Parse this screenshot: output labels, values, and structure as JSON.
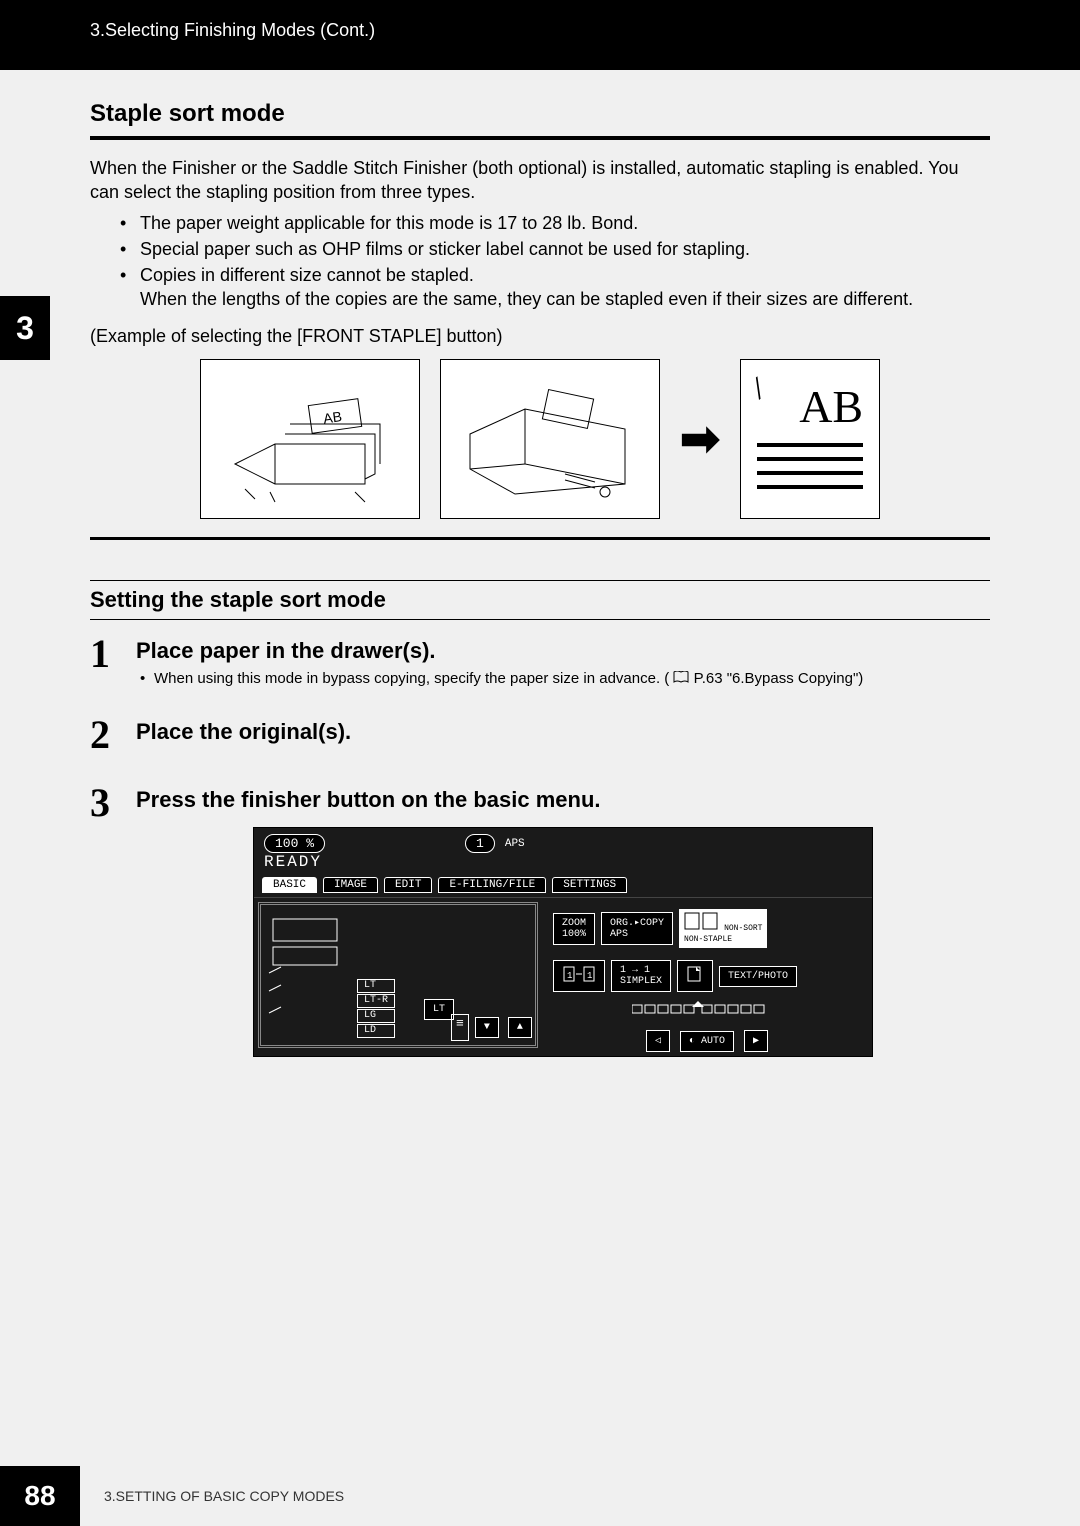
{
  "header": {
    "breadcrumb": "3.Selecting Finishing Modes (Cont.)"
  },
  "sideTab": "3",
  "section1": {
    "title": "Staple sort mode",
    "intro": "When the Finisher or the Saddle Stitch Finisher (both optional) is installed, automatic stapling is enabled. You can select the stapling position from three types.",
    "bullets": [
      "The paper weight applicable for this mode is 17 to 28 lb. Bond.",
      "Special paper such as OHP films or sticker label cannot be used for stapling.",
      "Copies in different size cannot be stapled."
    ],
    "bulletTail": "When the lengths of the copies are the same, they can be stapled even if their sizes are different.",
    "example": "(Example of selecting the [FRONT STAPLE] button)",
    "abLabel": "AB"
  },
  "section2": {
    "title": "Setting the staple sort mode",
    "steps": [
      {
        "num": "1",
        "title": "Place paper in the drawer(s).",
        "note_pre": "When using this mode in bypass copying, specify the paper size in advance. (",
        "note_ref": " P.63 \"6.Bypass Copying\")"
      },
      {
        "num": "2",
        "title": "Place the original(s)."
      },
      {
        "num": "3",
        "title": "Press the finisher button on the basic menu."
      }
    ]
  },
  "screen": {
    "zoom": "100",
    "pct": "%",
    "copies": "1",
    "aps": "APS",
    "ready": "READY",
    "tabs": [
      "BASIC",
      "IMAGE",
      "EDIT",
      "E-FILING/FILE",
      "SETTINGS"
    ],
    "trays": [
      "LT",
      "LT-R",
      "LG",
      "LD"
    ],
    "trayCur": "LT",
    "zoomBtn1": "ZOOM",
    "zoomBtn2": "100%",
    "orgcopy1": "ORG.▸COPY",
    "orgcopy2": "APS",
    "nonsort1": "NON-SORT",
    "nonsort2": "NON-STAPLE",
    "simplex": "1 → 1",
    "simplex2": "SIMPLEX",
    "textphoto": "TEXT/PHOTO",
    "auto": "AUTO"
  },
  "footer": {
    "page": "88",
    "chapter": "3.SETTING OF BASIC COPY MODES"
  }
}
